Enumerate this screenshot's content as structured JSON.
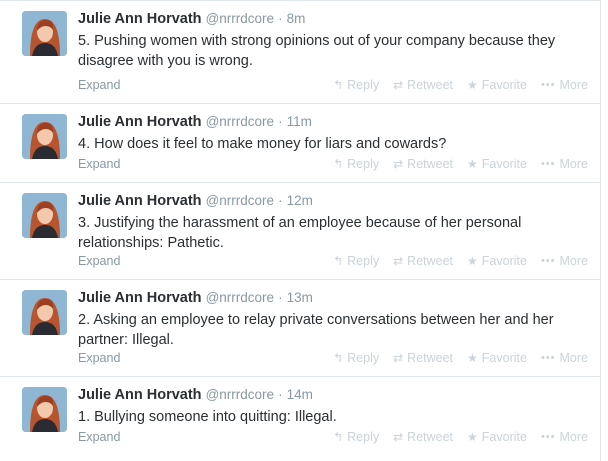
{
  "actions": {
    "expand": "Expand",
    "reply": "Reply",
    "retweet": "Retweet",
    "favorite": "Favorite",
    "more": "More"
  },
  "icons": {
    "reply": "reply-arrow-icon",
    "retweet": "retweet-icon",
    "favorite": "star-icon",
    "more": "ellipsis-icon"
  },
  "colors": {
    "name": "#292f33",
    "meta": "#8899a6",
    "action_faded": "#c9d3da",
    "divider": "#e1e8ed"
  },
  "tweets": [
    {
      "name": "Julie Ann Horvath",
      "handle": "@nrrrdcore",
      "time": "8m",
      "text": "5. Pushing women with strong opinions out of your company because they disagree with you is wrong."
    },
    {
      "name": "Julie Ann Horvath",
      "handle": "@nrrrdcore",
      "time": "11m",
      "text": "4. How does it feel to make money for liars and cowards?"
    },
    {
      "name": "Julie Ann Horvath",
      "handle": "@nrrrdcore",
      "time": "12m",
      "text": "3. Justifying the harassment of an employee because of her personal relationships: Pathetic."
    },
    {
      "name": "Julie Ann Horvath",
      "handle": "@nrrrdcore",
      "time": "13m",
      "text": "2. Asking an employee to relay private conversations between her and her partner: Illegal."
    },
    {
      "name": "Julie Ann Horvath",
      "handle": "@nrrrdcore",
      "time": "14m",
      "text": "1. Bullying someone into quitting: Illegal."
    }
  ]
}
